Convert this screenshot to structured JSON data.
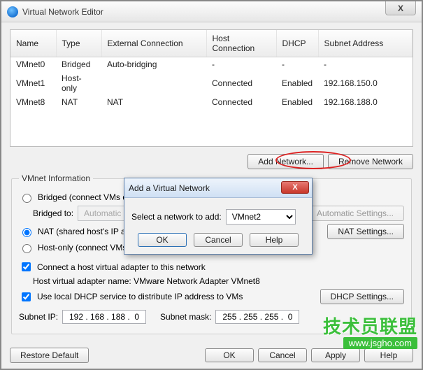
{
  "window": {
    "title": "Virtual Network Editor",
    "close": "X"
  },
  "table": {
    "headers": [
      "Name",
      "Type",
      "External Connection",
      "Host Connection",
      "DHCP",
      "Subnet Address"
    ],
    "rows": [
      {
        "name": "VMnet0",
        "type": "Bridged",
        "ext": "Auto-bridging",
        "host": "-",
        "dhcp": "-",
        "subnet": "-"
      },
      {
        "name": "VMnet1",
        "type": "Host-only",
        "ext": "",
        "host": "Connected",
        "dhcp": "Enabled",
        "subnet": "192.168.150.0"
      },
      {
        "name": "VMnet8",
        "type": "NAT",
        "ext": "NAT",
        "host": "Connected",
        "dhcp": "Enabled",
        "subnet": "192.168.188.0"
      }
    ]
  },
  "buttons": {
    "add_network": "Add Network...",
    "remove_network": "Remove Network",
    "automatic_settings": "Automatic Settings...",
    "nat_settings": "NAT Settings...",
    "dhcp_settings": "DHCP Settings...",
    "restore_default": "Restore Default",
    "ok": "OK",
    "cancel": "Cancel",
    "apply": "Apply",
    "help": "Help"
  },
  "group": {
    "legend": "VMnet Information",
    "bridged_label": "Bridged (connect VMs directly to the external network)",
    "bridged_to_label": "Bridged to:",
    "bridged_to_value": "Automatic",
    "nat_label": "NAT (shared host's IP address with VMs)",
    "hostonly_label": "Host-only (connect VMs internally in a private network)",
    "connect_adapter_label": "Connect a host virtual adapter to this network",
    "adapter_name_label": "Host virtual adapter name: VMware Network Adapter VMnet8",
    "dhcp_service_label": "Use local DHCP service to distribute IP address to VMs",
    "subnet_ip_label": "Subnet IP:",
    "subnet_ip_value": "192 . 168 . 188 .  0",
    "subnet_mask_label": "Subnet mask:",
    "subnet_mask_value": "255 . 255 . 255 .  0"
  },
  "dialog": {
    "title": "Add a Virtual Network",
    "close": "X",
    "prompt": "Select a network to add:",
    "selected": "VMnet2",
    "ok": "OK",
    "cancel": "Cancel",
    "help": "Help"
  },
  "watermark": {
    "line1": "技术员联盟",
    "line2": "www.jsgho.com"
  }
}
